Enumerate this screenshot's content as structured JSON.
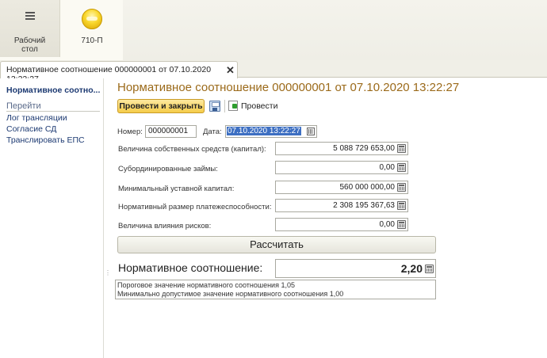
{
  "top_panel": {
    "sections": [
      {
        "label_line1": "Рабочий",
        "label_line2": "стол",
        "icon": "hamburger-icon"
      },
      {
        "label": "710-П",
        "icon": "yellow-circle-icon"
      }
    ]
  },
  "tab": {
    "title": "Нормативное соотношение 000000001 от 07.10.2020 13:22:27",
    "close": "✕"
  },
  "nav": {
    "current": "Нормативное соотно...",
    "goto_header": "Перейти",
    "links": [
      "Лог трансляции",
      "Согласие СД",
      "Транслировать ЕПС"
    ]
  },
  "form": {
    "title": "Нормативное соотношение 000000001 от 07.10.2020 13:22:27",
    "toolbar": {
      "post_close_label": "Провести и закрыть",
      "post_label": "Провести"
    },
    "number_label": "Номер:",
    "number_value": "000000001",
    "date_label": "Дата:",
    "date_value": "07.10.2020 13:22:27",
    "fields": [
      {
        "label": "Величина собственных средств (капитал):",
        "value": "5 088 729 653,00"
      },
      {
        "label": "Субординированные займы:",
        "value": "0,00"
      },
      {
        "label": "Минимальный уставной капитал:",
        "value": "560 000 000,00"
      },
      {
        "label": "Нормативный размер платежеспособности:",
        "value": "2 308 195 367,63"
      },
      {
        "label": "Величина влияния рисков:",
        "value": "0,00"
      }
    ],
    "calculate_label": "Рассчитать",
    "ratio_label": "Нормативное соотношение:",
    "ratio_value": "2,20",
    "notes": [
      "Пороговое значение нормативного соотношения 1,05",
      "Минимально допустимое значение нормативного соотношения 1,00"
    ]
  },
  "colors": {
    "title": "#9b6a1a",
    "nav_link": "#1d3a72",
    "primary_button": "#f5cc4a",
    "selection": "#3d6fc2"
  }
}
